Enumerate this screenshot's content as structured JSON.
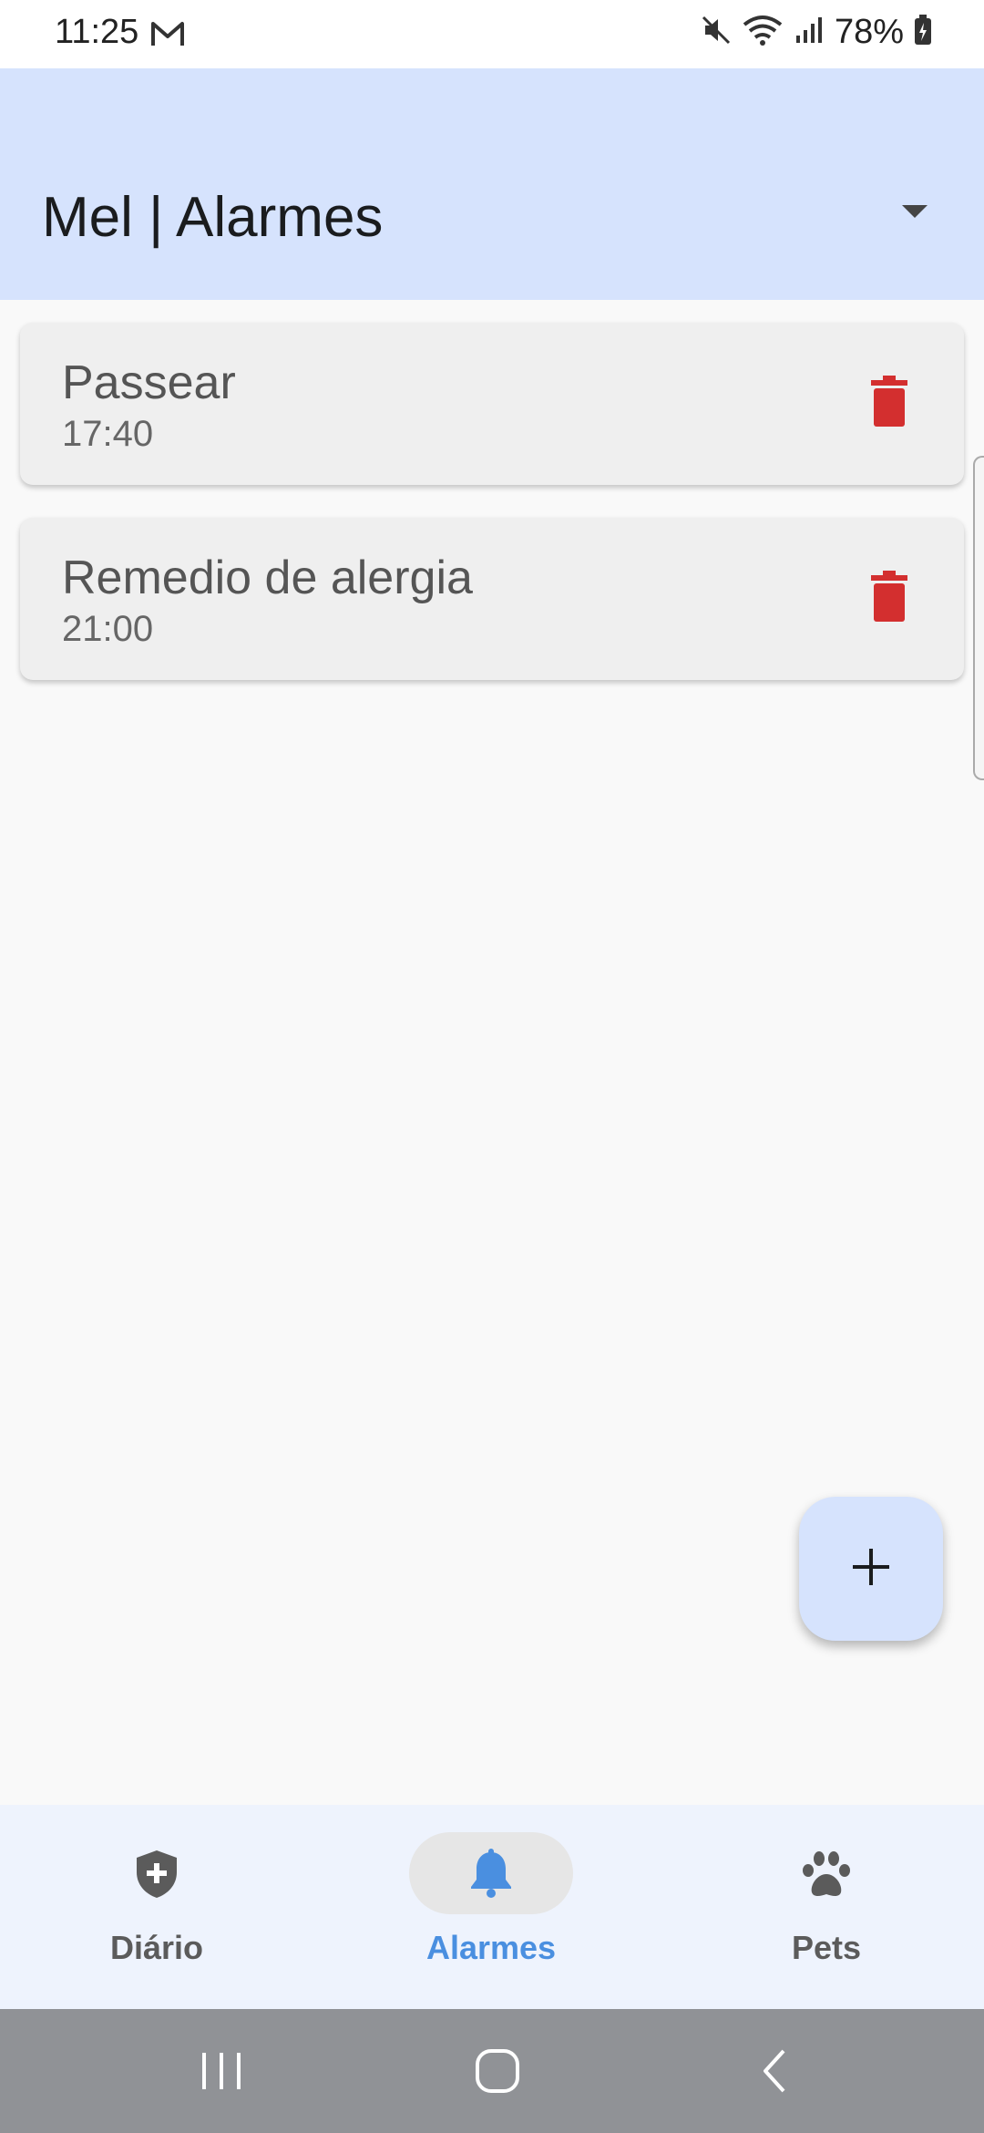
{
  "status_bar": {
    "time": "11:25",
    "battery": "78%"
  },
  "header": {
    "title": "Mel | Alarmes"
  },
  "alarms": [
    {
      "name": "Passear",
      "time": "17:40"
    },
    {
      "name": "Remedio de alergia",
      "time": "21:00"
    }
  ],
  "fab": {
    "icon": "plus-icon"
  },
  "bottom_nav": [
    {
      "label": "Diário",
      "icon": "shield-plus-icon",
      "active": false
    },
    {
      "label": "Alarmes",
      "icon": "bell-icon",
      "active": true
    },
    {
      "label": "Pets",
      "icon": "paw-icon",
      "active": false
    }
  ],
  "colors": {
    "header_bg": "#d6e3fd",
    "delete_red": "#d32f2f",
    "active_blue": "#4a8fe0"
  }
}
